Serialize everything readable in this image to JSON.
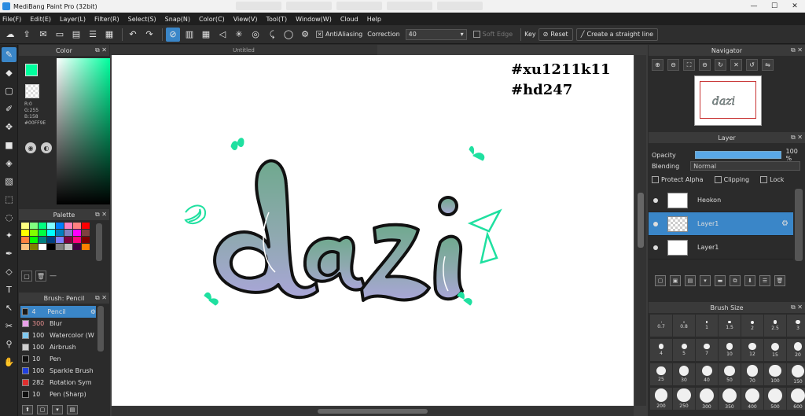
{
  "window": {
    "title": "MediBang Paint Pro (32bit)"
  },
  "menu": [
    "File(F)",
    "Edit(E)",
    "Layer(L)",
    "Filter(R)",
    "Select(S)",
    "Snap(N)",
    "Color(C)",
    "View(V)",
    "Tool(T)",
    "Window(W)",
    "Cloud",
    "Help"
  ],
  "toolbar": {
    "antialiasing_label": "AntiAliasing",
    "correction_label": "Correction",
    "correction_value": "40",
    "soft_edge_label": "Soft Edge",
    "key_label": "Key",
    "reset_label": "Reset",
    "straight_line_label": "Create a straight line"
  },
  "color_panel": {
    "title": "Color",
    "foreground": "#00FF9E",
    "r_text": "R:0",
    "g_text": "G:255",
    "b_text": "B:158",
    "hex_text": "#00FF9E"
  },
  "palette_panel": {
    "title": "Palette",
    "colors": [
      "#ffff80",
      "#80ff80",
      "#00ff80",
      "#80ffff",
      "#0080ff",
      "#ff80c0",
      "#ff8080",
      "#ff0000",
      "#ffff00",
      "#80ff00",
      "#00ff40",
      "#00ffff",
      "#0080c0",
      "#8080c0",
      "#ff00ff",
      "#804040",
      "#ff8040",
      "#00ff00",
      "#008080",
      "#004080",
      "#8080ff",
      "#800040",
      "#ff0080",
      "#800000",
      "#ffc080",
      "#808000",
      "#ffffff",
      "#000000",
      "#808080",
      "#c0c0c0",
      "#400040",
      "#ff8000"
    ]
  },
  "brush_panel": {
    "title": "Brush: Pencil",
    "brushes": [
      {
        "size": "4",
        "name": "Pencil",
        "color": "#1a1a1a",
        "selected": true
      },
      {
        "size": "300",
        "name": "Blur",
        "color": "#e8a0e8",
        "selected": false
      },
      {
        "size": "100",
        "name": "Watercolor (W",
        "color": "#80c8f0",
        "selected": false
      },
      {
        "size": "100",
        "name": "Airbrush",
        "color": "#d0d0d0",
        "selected": false
      },
      {
        "size": "10",
        "name": "Pen",
        "color": "#101010",
        "selected": false
      },
      {
        "size": "100",
        "name": "Sparkle Brush",
        "color": "#2040e0",
        "selected": false
      },
      {
        "size": "282",
        "name": "Rotation Sym",
        "color": "#e03030",
        "selected": false
      },
      {
        "size": "10",
        "name": "Pen (Sharp)",
        "color": "#101010",
        "selected": false
      }
    ]
  },
  "canvas": {
    "tab_title": "Untitled",
    "overlay_line1": "#xu1211k11",
    "overlay_line2": "#hd247"
  },
  "navigator": {
    "title": "Navigator"
  },
  "layer_panel": {
    "title": "Layer",
    "opacity_label": "Opacity",
    "opacity_value": "100 %",
    "blending_label": "Blending",
    "blending_value": "Normal",
    "protect_alpha_label": "Protect Alpha",
    "clipping_label": "Clipping",
    "lock_label": "Lock",
    "layers": [
      {
        "name": "Heokon",
        "selected": false
      },
      {
        "name": "Layer1",
        "selected": true
      },
      {
        "name": "Layer1",
        "selected": false
      }
    ]
  },
  "brush_size_panel": {
    "title": "Brush Size",
    "sizes": [
      "0.7",
      "0.8",
      "1",
      "1.5",
      "2",
      "2.5",
      "3",
      "4",
      "5",
      "7",
      "10",
      "12",
      "15",
      "20",
      "25",
      "30",
      "40",
      "50",
      "70",
      "100",
      "150",
      "200",
      "250",
      "300",
      "350",
      "400",
      "500",
      "600"
    ]
  }
}
